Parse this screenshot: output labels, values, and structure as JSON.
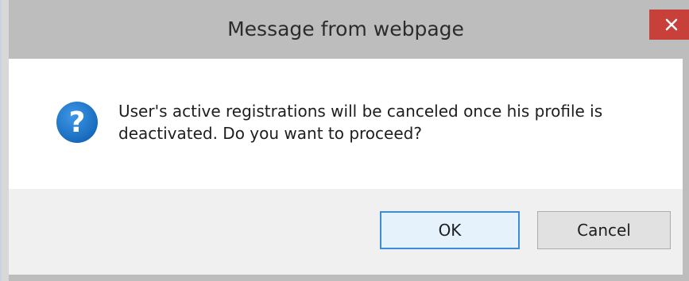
{
  "dialog": {
    "title": "Message from webpage",
    "close_icon": "close-icon",
    "icon": "question-icon",
    "message": "User's active registrations will be canceled once his profile is deactivated. Do you want to proceed?",
    "buttons": {
      "ok_label": "OK",
      "cancel_label": "Cancel"
    }
  },
  "colors": {
    "titlebar": "#bdbdbd",
    "close_button": "#c7403a",
    "icon_blue": "#1a73c9",
    "ok_border": "#3c8cd6",
    "footer": "#f0f0f0"
  }
}
